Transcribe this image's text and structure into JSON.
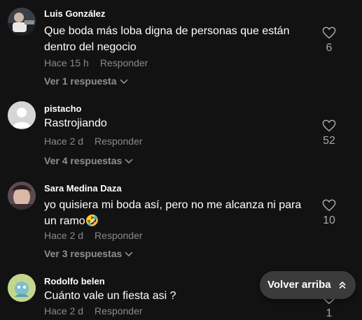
{
  "comments": [
    {
      "author": "Luis González",
      "text": "Que boda más loba digna de personas que están dentro del negocio",
      "time": "Hace 15 h",
      "reply_label": "Responder",
      "replies_label": "Ver 1 respuesta",
      "likes": "6",
      "avatar": "photo"
    },
    {
      "author": "pistacho",
      "text": "Rastrojiando",
      "time": "Hace 2 d",
      "reply_label": "Responder",
      "replies_label": "Ver 4 respuestas",
      "likes": "52",
      "avatar": "default-user"
    },
    {
      "author": "Sara Medina Daza",
      "text": "yo quisiera mi boda así, pero no me alcanza ni para un ramo",
      "emoji": "🤣",
      "time": "Hace 2 d",
      "reply_label": "Responder",
      "replies_label": "Ver 3 respuestas",
      "likes": "10",
      "avatar": "photo"
    },
    {
      "author": "Rodolfo belen",
      "text": "Cuánto vale un fiesta asi ?",
      "time": "Hace 2 d",
      "reply_label": "Responder",
      "likes": "1",
      "avatar": "cartoon"
    }
  ],
  "back_to_top": {
    "label": "Volver arriba"
  },
  "colors": {
    "background": "#121212",
    "muted": "#8a8a8a",
    "pill": "#3b3b3b"
  }
}
